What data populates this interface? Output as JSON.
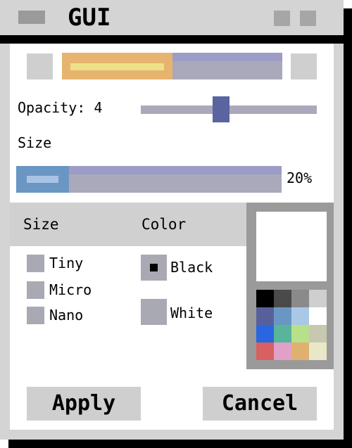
{
  "window": {
    "title": "GUI",
    "icons": {
      "menu": "window-menu-icon",
      "minimize": "minimize-icon",
      "maximize": "maximize-icon"
    }
  },
  "scroll_selector": {
    "fill_fraction": 0.5
  },
  "opacity": {
    "label": "Opacity: 4",
    "value": 4,
    "slider_fraction": 0.45
  },
  "size_slider": {
    "label": "Size",
    "percent_label": "20%",
    "value_fraction": 0.2
  },
  "size_options": {
    "header": "Size",
    "items": [
      {
        "label": "Tiny",
        "checked": false
      },
      {
        "label": "Micro",
        "checked": false
      },
      {
        "label": "Nano",
        "checked": false
      }
    ]
  },
  "color_options": {
    "header": "Color",
    "items": [
      {
        "label": "Black",
        "selected": true
      },
      {
        "label": "White",
        "selected": false
      }
    ]
  },
  "palette": {
    "preview_color": "#ffffff",
    "swatches": [
      "#000000",
      "#4a4a4a",
      "#8a8a8a",
      "#cfcfcf",
      "#58609c",
      "#6a96c4",
      "#a8c8e6",
      "#ffffff",
      "#2a66e0",
      "#58b49a",
      "#b8e08a",
      "#c8c8b0",
      "#d86060",
      "#e0a0c8",
      "#e0b070",
      "#e8e8c8"
    ]
  },
  "buttons": {
    "apply": "Apply",
    "cancel": "Cancel"
  },
  "colors": {
    "track": "#a9a9bb",
    "track_top": "#9c9cc6",
    "thumb": "#5a64a0",
    "orange_fill": "#e6b46e",
    "yellow_inner": "#eee088",
    "blue_fill": "#6a96c4",
    "blue_inner": "#a8c4e4"
  }
}
